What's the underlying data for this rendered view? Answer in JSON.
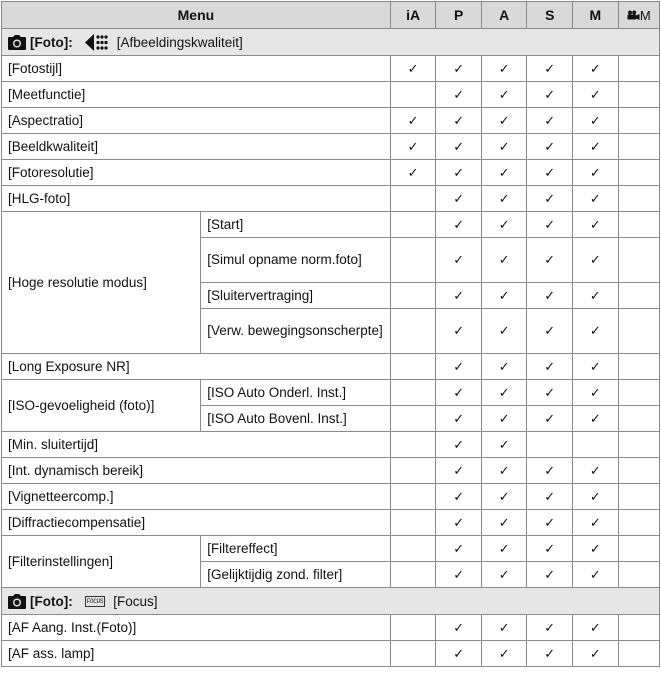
{
  "header": {
    "menu": "Menu",
    "modes": [
      "iA",
      "P",
      "A",
      "S",
      "M",
      "M"
    ]
  },
  "section1": {
    "label": "[Foto]:",
    "sub": "[Afbeeldingskwaliteit]"
  },
  "section2": {
    "label": "[Foto]:",
    "sub": "[Focus]",
    "icon_text": "FOCUS"
  },
  "check": "✓",
  "rows": {
    "fotostijl": {
      "label": "[Fotostijl]"
    },
    "meetfunctie": {
      "label": "[Meetfunctie]"
    },
    "aspectratio": {
      "label": "[Aspectratio]"
    },
    "beeldkwaliteit": {
      "label": "[Beeldkwaliteit]"
    },
    "fotoresolutie": {
      "label": "[Fotoresolutie]"
    },
    "hlg": {
      "label": "[HLG-foto]"
    },
    "hoge": {
      "label": "[Hoge resolutie modus]",
      "sub": [
        "[Start]",
        "[Simul opname norm.foto]",
        "[Sluitervertraging]",
        "[Verw. bewegingsonscherpte]"
      ]
    },
    "longexp": {
      "label": "[Long Exposure NR]"
    },
    "iso": {
      "label": "[ISO-gevoeligheid (foto)]",
      "sub": [
        "[ISO Auto Onderl. Inst.]",
        "[ISO Auto Bovenl. Inst.]"
      ]
    },
    "minsluiter": {
      "label": "[Min. sluitertijd]"
    },
    "intdyn": {
      "label": "[Int. dynamisch bereik]"
    },
    "vignet": {
      "label": "[Vignetteercomp.]"
    },
    "diffractie": {
      "label": "[Diffractiecompensatie]"
    },
    "filter": {
      "label": "[Filterinstellingen]",
      "sub": [
        "[Filtereffect]",
        "[Gelijktijdig zond. filter]"
      ]
    },
    "afaang": {
      "label": "[AF Aang. Inst.(Foto)]"
    },
    "afass": {
      "label": "[AF ass. lamp]"
    }
  }
}
